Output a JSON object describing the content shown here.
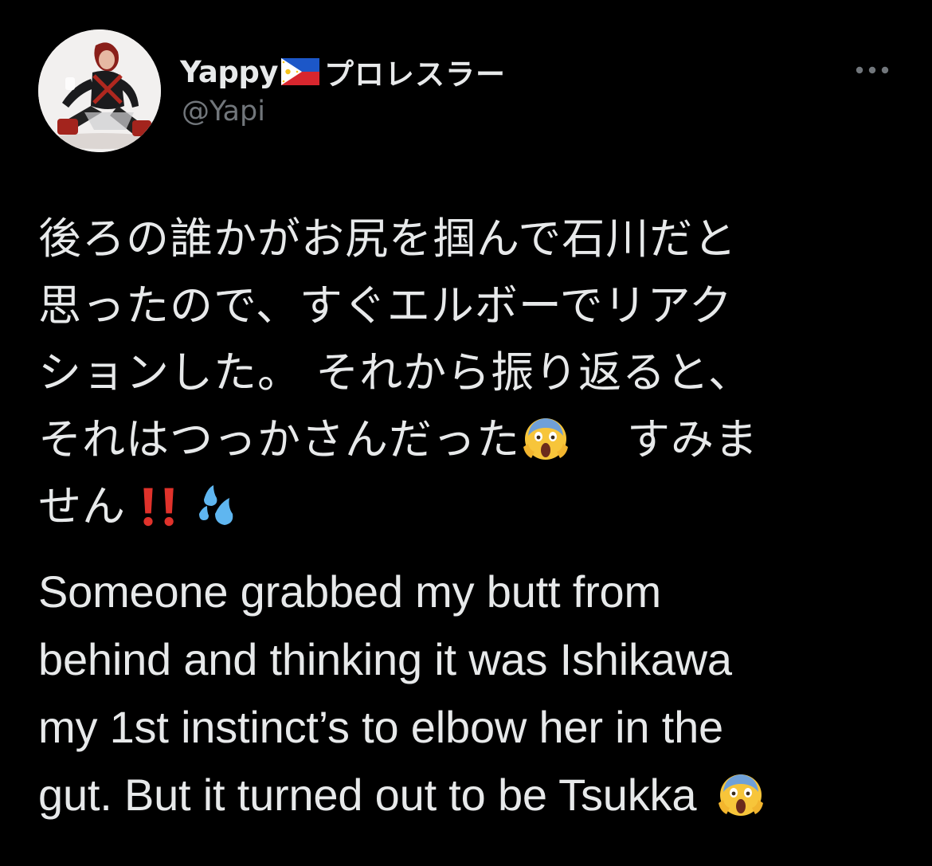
{
  "tweet": {
    "author": {
      "name_latin": "Yappy",
      "name_jp": "プロレスラー",
      "flag": "philippines-flag-icon",
      "handle": "@Yapi"
    },
    "more_icon": "more-horizontal-icon",
    "text_jp_lines": [
      "後ろの誰かがお尻を掴んで石川だと",
      "思ったので、すぐエルボーでリアク",
      "ションした。 それから振り返ると、",
      "それはつっかさんだった",
      "すみま",
      "せん"
    ],
    "text_en_lines": [
      "Someone grabbed my butt from",
      "behind and thinking it was Ishikawa",
      "my 1st instinct’s to elbow her in the",
      "gut. But it turned out to be Tsukka"
    ],
    "emojis": {
      "scream": "screaming-face-icon",
      "double_exclamation": "double-exclamation-icon",
      "sweat": "sweat-droplets-icon"
    },
    "colors": {
      "background": "#000000",
      "text": "#e7e9ea",
      "secondary": "#71767b"
    }
  }
}
